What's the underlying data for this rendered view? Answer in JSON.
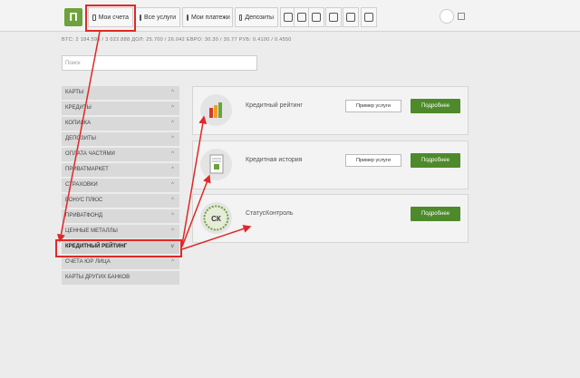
{
  "topbar": {
    "logo_letter": "П",
    "tabs": [
      {
        "label": "Мои счета",
        "icon": "card-icon"
      },
      {
        "label": "Все услуги",
        "icon": "list-icon"
      },
      {
        "label": "Мои платежи",
        "icon": "payments-icon"
      },
      {
        "label": "Депозиты",
        "icon": "deposit-icon"
      }
    ],
    "icon_tabs": [
      "transfer-icon",
      "phone-icon",
      "bonus-icon",
      "history-icon",
      "calculator-icon",
      "cart-icon"
    ]
  },
  "rates": {
    "text": "BTC: 2 184.595 / 3 022.888     ДОЛ: 25.700 / 26.042     ЕВРО: 30.30 / 30.77     РУБ: 0.4100 / 0.4550"
  },
  "search": {
    "placeholder": "Поиск"
  },
  "sidebar": {
    "items": [
      {
        "label": "КАРТЫ"
      },
      {
        "label": "КРЕДИТЫ"
      },
      {
        "label": "КОПИЛКА"
      },
      {
        "label": "ДЕПОЗИТЫ"
      },
      {
        "label": "ОПЛАТА ЧАСТЯМИ"
      },
      {
        "label": "ПРИВАТМАРКЕТ"
      },
      {
        "label": "СТРАХОВКИ"
      },
      {
        "label": "БОНУС ПЛЮС"
      },
      {
        "label": "ПРИВАТФОНД"
      },
      {
        "label": "ЦЕННЫЕ МЕТАЛЛЫ"
      },
      {
        "label": "КРЕДИТНЫЙ РЕЙТИНГ"
      },
      {
        "label": "СЧЕТА ЮР ЛИЦА"
      },
      {
        "label": "КАРТЫ ДРУГИХ БАНКОВ"
      }
    ],
    "active_index": 10
  },
  "cards": [
    {
      "title": "Кредитный рейтинг",
      "example_label": "Пример услуги",
      "more_label": "Подробнее",
      "icon": "rating-bars-icon"
    },
    {
      "title": "Кредитная история",
      "example_label": "Пример услуги",
      "more_label": "Подробнее",
      "icon": "document-icon"
    },
    {
      "title": "СтатусКонтроль",
      "more_label": "Подробнее",
      "icon": "sk-badge-icon",
      "icon_text": "СК"
    }
  ],
  "colors": {
    "accent_green": "#4e8a2b",
    "logo_green": "#6ea23c",
    "annotation_red": "#e02828"
  }
}
